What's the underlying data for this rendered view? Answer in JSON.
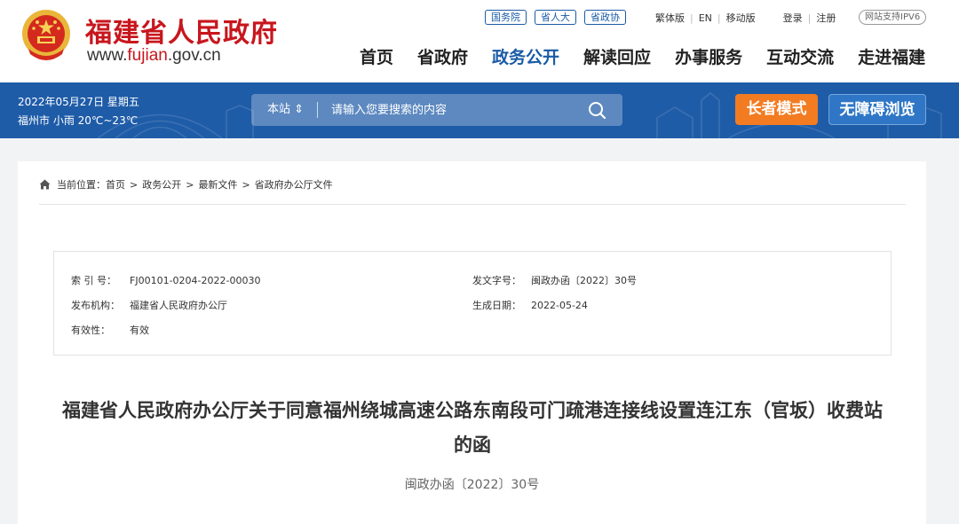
{
  "header": {
    "site_title": "福建省人民政府",
    "site_url_prefix": "www.",
    "site_url_highlight": "fujian",
    "site_url_suffix": ".gov.cn",
    "ext_links": [
      "国务院",
      "省人大",
      "省政协"
    ],
    "util_links": [
      "繁体版",
      "EN",
      "移动版"
    ],
    "login": "登录",
    "register": "注册",
    "ipv6": "网站支持IPV6",
    "nav": [
      "首页",
      "省政府",
      "政务公开",
      "解读回应",
      "办事服务",
      "互动交流",
      "走进福建"
    ],
    "active_nav": "政务公开"
  },
  "bar": {
    "date": "2022年05月27日 星期五",
    "weather": "福州市 小雨 20℃~23℃",
    "search_scope": "本站 ⇕",
    "search_placeholder": "请输入您要搜索的内容",
    "elder_mode": "长者模式",
    "accessible": "无障碍浏览"
  },
  "breadcrumb": {
    "prefix": "当前位置：",
    "items": [
      "首页",
      "政务公开",
      "最新文件",
      "省政府办公厅文件"
    ],
    "separator": ">"
  },
  "meta": {
    "index_label": "索 引 号：",
    "index_value": "FJ00101-0204-2022-00030",
    "doc_no_label": "发文字号：",
    "doc_no_value": "闽政办函〔2022〕30号",
    "publisher_label": "发布机构：",
    "publisher_value": "福建省人民政府办公厅",
    "date_label": "生成日期：",
    "date_value": "2022-05-24",
    "validity_label": "有效性：",
    "validity_value": "有效"
  },
  "document": {
    "title": "福建省人民政府办公厅关于同意福州绕城高速公路东南段可门疏港连接线设置连江东（官坂）收费站的函",
    "number": "闽政办函〔2022〕30号"
  },
  "colors": {
    "brand_red": "#c8161d",
    "brand_blue": "#1f5ca8",
    "elder_orange": "#f37b21"
  }
}
